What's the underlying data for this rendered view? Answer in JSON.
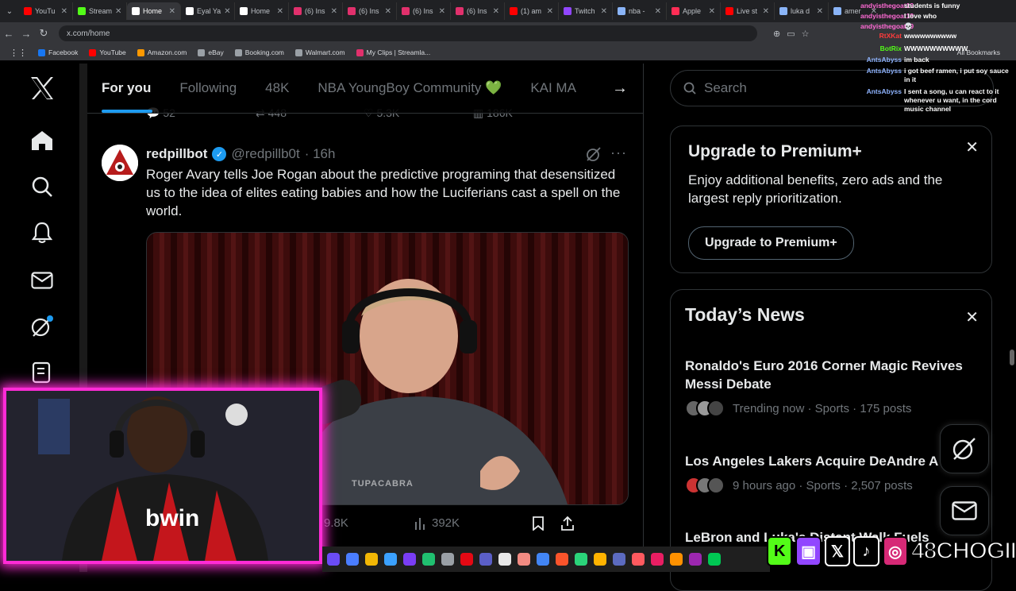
{
  "browser": {
    "tabs": [
      {
        "label": "YouTu",
        "color": "#ff0000"
      },
      {
        "label": "Stream",
        "color": "#53fc18"
      },
      {
        "label": "Home",
        "color": "#ffffff",
        "active": true
      },
      {
        "label": "Eyal Ya",
        "color": "#ffffff"
      },
      {
        "label": "Home",
        "color": "#ffffff"
      },
      {
        "label": "(6) Ins",
        "color": "#e1306c"
      },
      {
        "label": "(6) Ins",
        "color": "#e1306c"
      },
      {
        "label": "(6) Ins",
        "color": "#e1306c"
      },
      {
        "label": "(6) Ins",
        "color": "#e1306c"
      },
      {
        "label": "(1) am",
        "color": "#ff0000"
      },
      {
        "label": "Twitch",
        "color": "#9146ff"
      },
      {
        "label": "nba -",
        "color": "#8ab4f8"
      },
      {
        "label": "Apple",
        "color": "#ff2d55"
      },
      {
        "label": "Live st",
        "color": "#ff0000"
      },
      {
        "label": "luka d",
        "color": "#8ab4f8"
      },
      {
        "label": "amer",
        "color": "#8ab4f8"
      }
    ],
    "url": "x.com/home",
    "bookmarks": [
      {
        "label": "Facebook",
        "color": "#1877f2"
      },
      {
        "label": "YouTube",
        "color": "#ff0000"
      },
      {
        "label": "Amazon.com",
        "color": "#ff9900"
      },
      {
        "label": "eBay",
        "color": "#9aa0a6"
      },
      {
        "label": "Booking.com",
        "color": "#9aa0a6"
      },
      {
        "label": "Walmart.com",
        "color": "#9aa0a6"
      },
      {
        "label": "My Clips | Streamla...",
        "color": "#e1306c"
      }
    ],
    "all_bookmarks": "All Bookmarks"
  },
  "feed": {
    "tabs": [
      "For you",
      "Following",
      "48K",
      "NBA YoungBoy Community 💚",
      "KAI MA"
    ],
    "prev_actions": {
      "replies": "52",
      "reposts": "448",
      "likes": "5.3K",
      "views": "186K"
    },
    "tweet": {
      "name": "redpillbot",
      "handle": "@redpillb0t",
      "time": "· 16h",
      "text": "Roger Avary tells Joe Rogan about the predictive programing that desensitized us to the idea of elites eating babies and how the Luciferians cast a spell on the world.",
      "watermark": "TUPACABRA",
      "likes": "9.8K",
      "views": "392K"
    }
  },
  "sidebar": {
    "search_placeholder": "Search",
    "premium": {
      "title": "Upgrade to Premium+",
      "body": "Enjoy additional benefits, zero ads and the largest reply prioritization.",
      "button": "Upgrade to Premium+"
    },
    "news": {
      "title": "Today’s News",
      "items": [
        {
          "title": "Ronaldo's Euro 2016 Corner Magic Revives Messi Debate",
          "meta": "Trending now · Sports · 175 posts"
        },
        {
          "title": "Los Angeles Lakers Acquire DeAndre A",
          "meta": "9 hours ago · Sports · 2,507 posts"
        },
        {
          "title": "LeBron and Luka's Distant Walk Fuels",
          "meta": ""
        }
      ]
    }
  },
  "chat": [
    {
      "user": "andyisthegoat19",
      "msg": "students is funny",
      "color": "#ff6ad5"
    },
    {
      "user": "andyisthegoat19",
      "msg": "I love who",
      "color": "#ff6ad5"
    },
    {
      "user": "andyisthegoat19",
      "msg": "💀",
      "color": "#ff6ad5"
    },
    {
      "user": "RtXKat",
      "msg": "wwwwwwwwww",
      "color": "#ff3b3b"
    },
    {
      "user": "BotRix",
      "msg": "WWWWWWWWWW",
      "color": "#53fc18"
    },
    {
      "user": "AntsAbyss",
      "msg": "im back",
      "color": "#8fb4ff"
    },
    {
      "user": "AntsAbyss",
      "msg": "i got beef ramen, i put soy sauce in it",
      "color": "#8fb4ff"
    },
    {
      "user": "AntsAbyss",
      "msg": "I sent a song, u can react to it whenever u want, in the cord music channel",
      "color": "#8fb4ff"
    }
  ],
  "overlay": {
    "channel_name": "48CHOGII",
    "social_icons": [
      "kick-icon",
      "twitch-icon",
      "x-icon",
      "tiktok-icon",
      "instagram-icon"
    ]
  },
  "colors": {
    "accent": "#1d9bf0",
    "border": "#2f3336",
    "muted": "#71767b",
    "webcam_frame": "#ff2bd6"
  }
}
